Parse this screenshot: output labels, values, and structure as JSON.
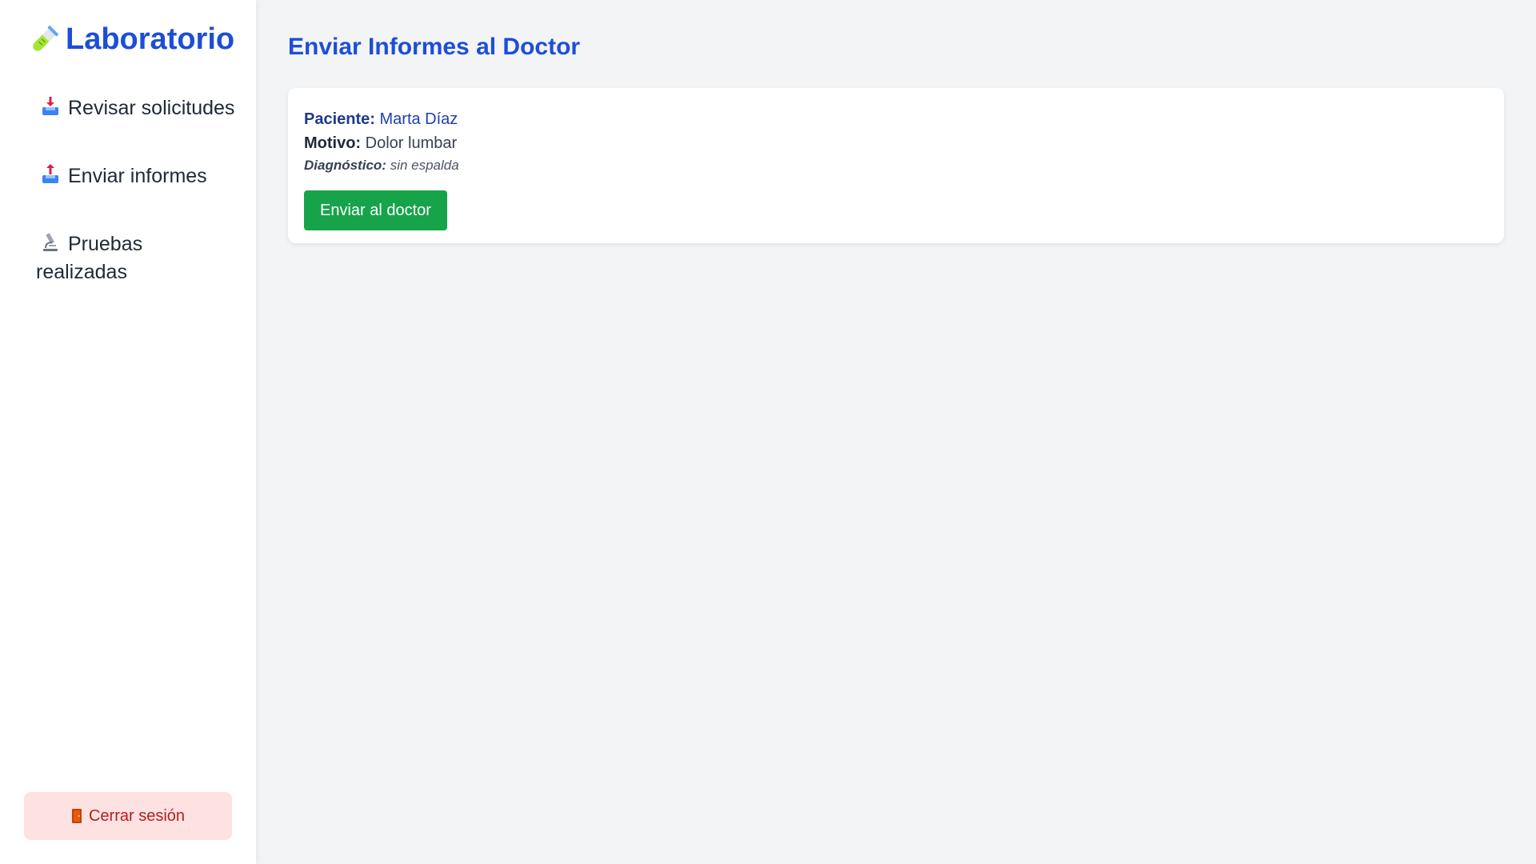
{
  "app": {
    "title": "Laboratorio",
    "logo_icon": "test-tube-icon",
    "accent_color": "#1d4ed8"
  },
  "sidebar": {
    "items": [
      {
        "label": "Revisar solicitudes",
        "icon": "inbox-tray-icon"
      },
      {
        "label": "Enviar informes",
        "icon": "outbox-tray-icon"
      },
      {
        "label": "Pruebas realizadas",
        "icon": "microscope-icon"
      }
    ],
    "logout": {
      "label": "Cerrar sesión",
      "icon": "door-icon"
    }
  },
  "main": {
    "title": "Enviar Informes al Doctor",
    "reports": [
      {
        "patient_label": "Paciente:",
        "patient_name": "Marta Díaz",
        "reason_label": "Motivo:",
        "reason_value": "Dolor lumbar",
        "diagnosis_label": "Diagnóstico:",
        "diagnosis_value": "sin espalda",
        "button_label": "Enviar al doctor",
        "button_color": "#16a34a"
      }
    ]
  }
}
